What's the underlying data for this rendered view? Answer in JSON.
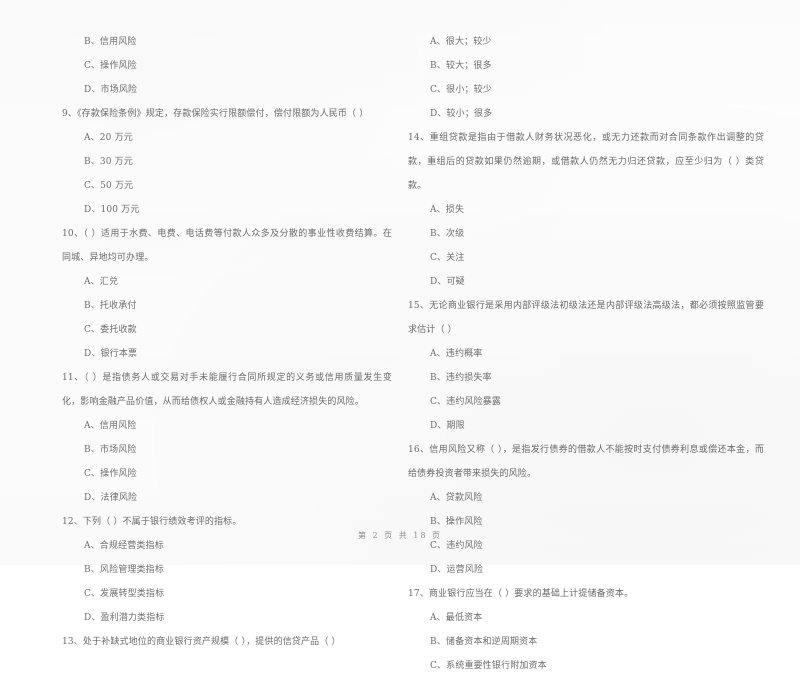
{
  "document": {
    "type": "exam-paper",
    "language": "zh-CN",
    "footer": "第 2 页 共 18 页"
  },
  "left_column": {
    "questions": [
      {
        "id": "q8-continued",
        "stem": "",
        "options": [
          "B、信用风险",
          "C、操作风险",
          "D、市场风险"
        ]
      },
      {
        "id": "q9",
        "number": "9",
        "stem": "9、《存款保险条例》规定，存款保险实行限额偿付，偿付限额为人民币（      ）",
        "options": [
          "A、20 万元",
          "B、30 万元",
          "C、50 万元",
          "D、100 万元"
        ]
      },
      {
        "id": "q10",
        "number": "10",
        "stem": "10、（      ）适用于水费、电费、电话费等付款人众多及分散的事业性收费结算。在同城、异地均可办理。",
        "options": [
          "A、汇兑",
          "B、托收承付",
          "C、委托收款",
          "D、银行本票"
        ]
      },
      {
        "id": "q11",
        "number": "11",
        "stem": "11、（      ）是指债务人或交易对手未能履行合同所规定的义务或信用质量发生变化，影响金融产品价值，从而给债权人或金融持有人造成经济损失的风险。",
        "options": [
          "A、信用风险",
          "B、市场风险",
          "C、操作风险",
          "D、法律风险"
        ]
      },
      {
        "id": "q12",
        "number": "12",
        "stem": "12、下列（      ）不属于银行绩效考评的指标。",
        "options": [
          "A、合规经营类指标",
          "B、风险管理类指标",
          "C、发展转型类指标",
          "D、盈利潜力类指标"
        ]
      },
      {
        "id": "q13",
        "number": "13",
        "stem": "13、处于补缺式地位的商业银行资产规模（      ），提供的信贷产品（      ）",
        "options": []
      }
    ]
  },
  "right_column": {
    "questions": [
      {
        "id": "q13-continued",
        "stem": "",
        "options": [
          "A、很大；较少",
          "B、较大；很多",
          "C、很小；较少",
          "D、较小；很多"
        ]
      },
      {
        "id": "q14",
        "number": "14",
        "stem": "14、重组贷款是指由于借款人财务状况恶化，或无力还款而对合同条款作出调整的贷款，重组后的贷款如果仍然逾期，或借款人仍然无力归还贷款，应至少归为（      ）类贷款。",
        "options": [
          "A、损失",
          "B、次级",
          "C、关注",
          "D、可疑"
        ]
      },
      {
        "id": "q15",
        "number": "15",
        "stem": "15、无论商业银行是采用内部评级法初级法还是内部评级法高级法，都必须按照监管要求估计（      ）",
        "options": [
          "A、违约概率",
          "B、违约损失率",
          "C、违约风险暴露",
          "D、期限"
        ]
      },
      {
        "id": "q16",
        "number": "16",
        "stem": "16、信用风险又称（      ），是指发行债券的借款人不能按时支付债券利息或偿还本金，而给债券投资者带来损失的风险。",
        "options": [
          "A、贷款风险",
          "B、操作风险",
          "C、违约风险",
          "D、运营风险"
        ]
      },
      {
        "id": "q17",
        "number": "17",
        "stem": "17、商业银行应当在（      ）要求的基础上计提储备资本。",
        "options": [
          "A、最低资本",
          "B、储备资本和逆周期资本",
          "C、系统重要性银行附加资本"
        ]
      }
    ]
  }
}
